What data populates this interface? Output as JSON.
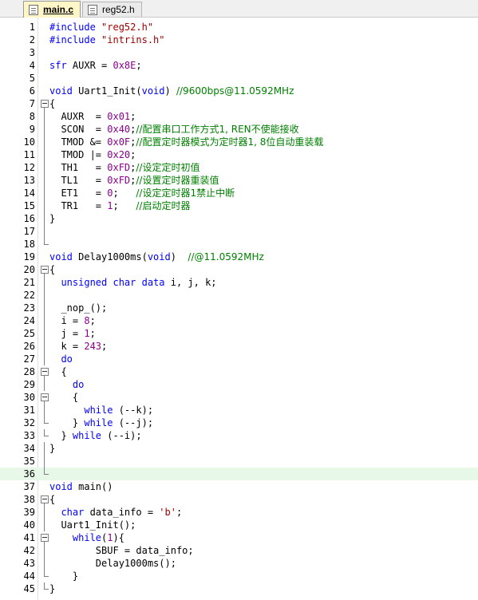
{
  "tabs": [
    {
      "label": "main.c",
      "active": true
    },
    {
      "label": "reg52.h",
      "active": false
    }
  ],
  "colors": {
    "keyword": "#0000ff",
    "number": "#8b008b",
    "string": "#a00000",
    "comment": "#008000",
    "current_line": "#e8f8e8"
  },
  "lines": [
    {
      "n": "1",
      "fold": "",
      "tokens": [
        [
          "pp",
          "#include "
        ],
        [
          "st",
          "\"reg52.h\""
        ]
      ]
    },
    {
      "n": "2",
      "fold": "",
      "tokens": [
        [
          "pp",
          "#include "
        ],
        [
          "st",
          "\"intrins.h\""
        ]
      ]
    },
    {
      "n": "3",
      "fold": "",
      "tokens": []
    },
    {
      "n": "4",
      "fold": "",
      "tokens": [
        [
          "kw",
          "sfr"
        ],
        [
          "t",
          " AUXR = "
        ],
        [
          "nm",
          "0x8E"
        ],
        [
          "t",
          ";"
        ]
      ]
    },
    {
      "n": "5",
      "fold": "",
      "tokens": []
    },
    {
      "n": "6",
      "fold": "",
      "tokens": [
        [
          "kw",
          "void"
        ],
        [
          "t",
          " Uart1_Init("
        ],
        [
          "kw",
          "void"
        ],
        [
          "t",
          ") "
        ],
        [
          "cm",
          "//9600bps@11.0592MHz"
        ]
      ]
    },
    {
      "n": "7",
      "fold": "open",
      "tokens": [
        [
          "t",
          "{"
        ]
      ]
    },
    {
      "n": "8",
      "fold": "mid",
      "tokens": [
        [
          "t",
          "  AUXR  = "
        ],
        [
          "nm",
          "0x01"
        ],
        [
          "t",
          ";"
        ]
      ]
    },
    {
      "n": "9",
      "fold": "mid",
      "tokens": [
        [
          "t",
          "  SCON  = "
        ],
        [
          "nm",
          "0x40"
        ],
        [
          "t",
          ";"
        ],
        [
          "cm",
          "//配置串口工作方式1, REN不使能接收"
        ]
      ]
    },
    {
      "n": "10",
      "fold": "mid",
      "tokens": [
        [
          "t",
          "  TMOD &= "
        ],
        [
          "nm",
          "0x0F"
        ],
        [
          "t",
          ";"
        ],
        [
          "cm",
          "//配置定时器模式为定时器1, 8位自动重装载"
        ]
      ]
    },
    {
      "n": "11",
      "fold": "mid",
      "tokens": [
        [
          "t",
          "  TMOD |= "
        ],
        [
          "nm",
          "0x20"
        ],
        [
          "t",
          ";"
        ]
      ]
    },
    {
      "n": "12",
      "fold": "mid",
      "tokens": [
        [
          "t",
          "  TH1   = "
        ],
        [
          "nm",
          "0xFD"
        ],
        [
          "t",
          ";"
        ],
        [
          "cm",
          "//设定定时初值"
        ]
      ]
    },
    {
      "n": "13",
      "fold": "mid",
      "tokens": [
        [
          "t",
          "  TL1   = "
        ],
        [
          "nm",
          "0xFD"
        ],
        [
          "t",
          ";"
        ],
        [
          "cm",
          "//设置定时器重装值"
        ]
      ]
    },
    {
      "n": "14",
      "fold": "mid",
      "tokens": [
        [
          "t",
          "  ET1   = "
        ],
        [
          "nm",
          "0"
        ],
        [
          "t",
          ";   "
        ],
        [
          "cm",
          "//设定定时器1禁止中断"
        ]
      ]
    },
    {
      "n": "15",
      "fold": "mid",
      "tokens": [
        [
          "t",
          "  TR1   = "
        ],
        [
          "nm",
          "1"
        ],
        [
          "t",
          ";   "
        ],
        [
          "cm",
          "//启动定时器"
        ]
      ]
    },
    {
      "n": "16",
      "fold": "mid",
      "tokens": [
        [
          "t",
          "}"
        ]
      ]
    },
    {
      "n": "17",
      "fold": "mid",
      "tokens": []
    },
    {
      "n": "18",
      "fold": "end",
      "tokens": []
    },
    {
      "n": "19",
      "fold": "",
      "tokens": [
        [
          "kw",
          "void"
        ],
        [
          "t",
          " Delay1000ms("
        ],
        [
          "kw",
          "void"
        ],
        [
          "t",
          ")  "
        ],
        [
          "cm",
          "//@11.0592MHz"
        ]
      ]
    },
    {
      "n": "20",
      "fold": "open",
      "tokens": [
        [
          "t",
          "{"
        ]
      ]
    },
    {
      "n": "21",
      "fold": "mid",
      "tokens": [
        [
          "t",
          "  "
        ],
        [
          "kw",
          "unsigned char data"
        ],
        [
          "t",
          " i, j, k;"
        ]
      ]
    },
    {
      "n": "22",
      "fold": "mid",
      "tokens": []
    },
    {
      "n": "23",
      "fold": "mid",
      "tokens": [
        [
          "t",
          "  _nop_();"
        ]
      ]
    },
    {
      "n": "24",
      "fold": "mid",
      "tokens": [
        [
          "t",
          "  i = "
        ],
        [
          "nm",
          "8"
        ],
        [
          "t",
          ";"
        ]
      ]
    },
    {
      "n": "25",
      "fold": "mid",
      "tokens": [
        [
          "t",
          "  j = "
        ],
        [
          "nm",
          "1"
        ],
        [
          "t",
          ";"
        ]
      ]
    },
    {
      "n": "26",
      "fold": "mid",
      "tokens": [
        [
          "t",
          "  k = "
        ],
        [
          "nm",
          "243"
        ],
        [
          "t",
          ";"
        ]
      ]
    },
    {
      "n": "27",
      "fold": "mid",
      "tokens": [
        [
          "t",
          "  "
        ],
        [
          "kw",
          "do"
        ]
      ]
    },
    {
      "n": "28",
      "fold": "open",
      "tokens": [
        [
          "t",
          "  {"
        ]
      ]
    },
    {
      "n": "29",
      "fold": "mid",
      "tokens": [
        [
          "t",
          "    "
        ],
        [
          "kw",
          "do"
        ]
      ]
    },
    {
      "n": "30",
      "fold": "open",
      "tokens": [
        [
          "t",
          "    {"
        ]
      ]
    },
    {
      "n": "31",
      "fold": "mid",
      "tokens": [
        [
          "t",
          "      "
        ],
        [
          "kw",
          "while"
        ],
        [
          "t",
          " (--k);"
        ]
      ]
    },
    {
      "n": "32",
      "fold": "end",
      "tokens": [
        [
          "t",
          "    } "
        ],
        [
          "kw",
          "while"
        ],
        [
          "t",
          " (--j);"
        ]
      ]
    },
    {
      "n": "33",
      "fold": "end",
      "tokens": [
        [
          "t",
          "  } "
        ],
        [
          "kw",
          "while"
        ],
        [
          "t",
          " (--i);"
        ]
      ]
    },
    {
      "n": "34",
      "fold": "mid",
      "tokens": [
        [
          "t",
          "}"
        ]
      ]
    },
    {
      "n": "35",
      "fold": "mid",
      "tokens": []
    },
    {
      "n": "36",
      "fold": "end",
      "tokens": [],
      "current": true
    },
    {
      "n": "37",
      "fold": "",
      "tokens": [
        [
          "kw",
          "void"
        ],
        [
          "t",
          " main()"
        ]
      ]
    },
    {
      "n": "38",
      "fold": "open",
      "tokens": [
        [
          "t",
          "{"
        ]
      ]
    },
    {
      "n": "39",
      "fold": "mid",
      "tokens": [
        [
          "t",
          "  "
        ],
        [
          "kw",
          "char"
        ],
        [
          "t",
          " data_info = "
        ],
        [
          "st",
          "'b'"
        ],
        [
          "t",
          ";"
        ]
      ]
    },
    {
      "n": "40",
      "fold": "mid",
      "tokens": [
        [
          "t",
          "  Uart1_Init();"
        ]
      ]
    },
    {
      "n": "41",
      "fold": "open",
      "tokens": [
        [
          "t",
          "    "
        ],
        [
          "kw",
          "while"
        ],
        [
          "t",
          "("
        ],
        [
          "nm",
          "1"
        ],
        [
          "t",
          "){"
        ]
      ]
    },
    {
      "n": "42",
      "fold": "mid",
      "tokens": [
        [
          "t",
          "        SBUF = data_info;"
        ]
      ]
    },
    {
      "n": "43",
      "fold": "mid",
      "tokens": [
        [
          "t",
          "        Delay1000ms();"
        ]
      ]
    },
    {
      "n": "44",
      "fold": "end",
      "tokens": [
        [
          "t",
          "    }"
        ]
      ]
    },
    {
      "n": "45",
      "fold": "end",
      "tokens": [
        [
          "t",
          "}"
        ]
      ]
    }
  ]
}
